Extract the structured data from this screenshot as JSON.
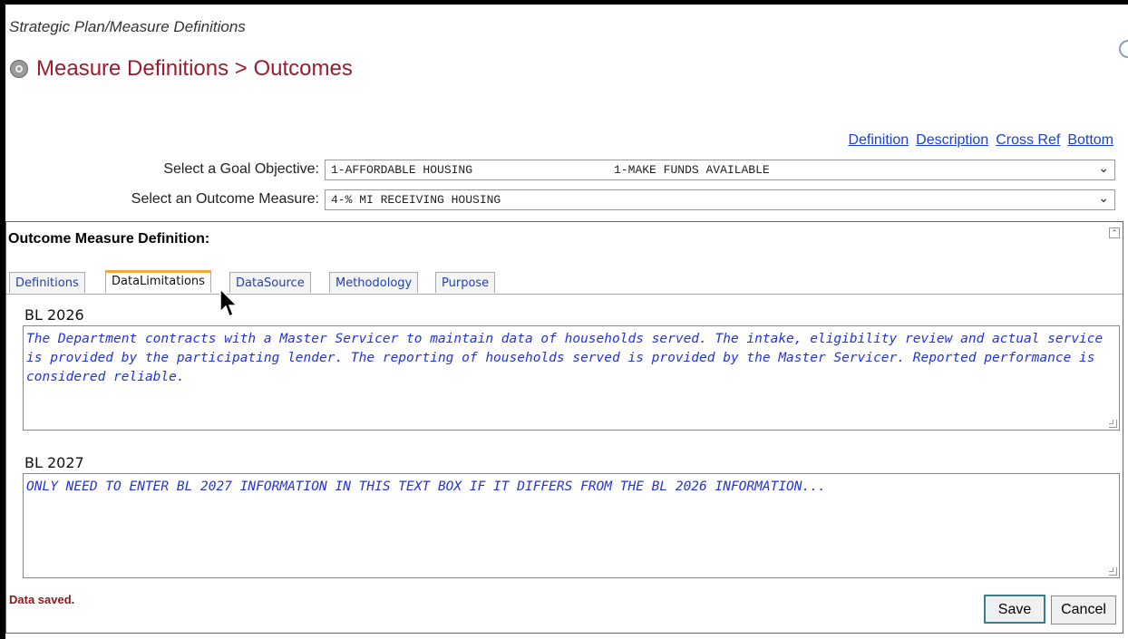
{
  "breadcrumb": "Strategic Plan/Measure Definitions",
  "page_title": "Measure Definitions > Outcomes",
  "nav_links": [
    "Definition",
    "Description",
    "Cross Ref",
    "Bottom"
  ],
  "goal_objective": {
    "label": "Select a Goal Objective:",
    "value": "1-AFFORDABLE HOUSING                    1-MAKE FUNDS AVAILABLE"
  },
  "outcome_measure": {
    "label": "Select an Outcome Measure:",
    "value": "4-% MI RECEIVING HOUSING"
  },
  "panel": {
    "title": "Outcome Measure Definition:",
    "tabs": [
      {
        "label": "Definitions",
        "active": false
      },
      {
        "label": "DataLimitations",
        "active": true
      },
      {
        "label": "DataSource",
        "active": false
      },
      {
        "label": "Methodology",
        "active": false
      },
      {
        "label": "Purpose",
        "active": false
      }
    ],
    "bl2026": {
      "label": "BL 2026",
      "text": "The Department contracts with a Master Servicer to maintain data of households served. The intake, eligibility review and actual service is provided by the participating lender. The reporting of households served is provided by the Master Servicer. Reported performance is considered reliable."
    },
    "bl2027": {
      "label": "BL 2027",
      "text": "ONLY NEED TO ENTER BL 2027 INFORMATION IN THIS TEXT BOX IF IT DIFFERS FROM THE BL 2026 INFORMATION..."
    },
    "status": "Data saved.",
    "save_label": "Save",
    "cancel_label": "Cancel"
  },
  "colors": {
    "title": "#9b1c2e",
    "link": "#1a3fd6",
    "textarea_text": "#2233dd",
    "active_tab_accent": "#f4a83a",
    "status": "#8b1a1a"
  }
}
